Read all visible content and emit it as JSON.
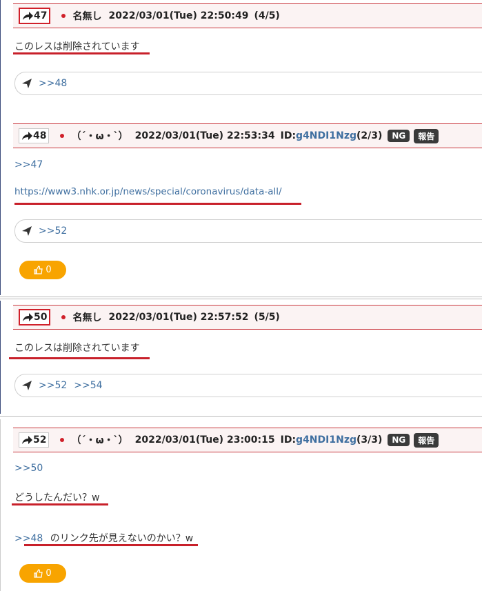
{
  "posts": [
    {
      "num": "47",
      "name": "名無し",
      "date": "2022/03/01(Tue) 22:50:49",
      "count": "(4/5)",
      "body": "このレスは削除されています",
      "replies": [
        ">>48"
      ]
    },
    {
      "num": "48",
      "name": "（´・ω・`）",
      "date": "2022/03/01(Tue) 22:53:34",
      "id_label": "ID:",
      "id": "g4NDI1Nzg",
      "count": "(2/3)",
      "ng": "NG",
      "report": "報告",
      "anchor": ">>47",
      "url": "https://www3.nhk.or.jp/news/special/coronavirus/data-all/",
      "replies": [
        ">>52"
      ],
      "likes": "0"
    },
    {
      "num": "50",
      "name": "名無し",
      "date": "2022/03/01(Tue) 22:57:52",
      "count": "(5/5)",
      "body": "このレスは削除されています",
      "replies": [
        ">>52",
        ">>54"
      ]
    },
    {
      "num": "52",
      "name": "（´・ω・`）",
      "date": "2022/03/01(Tue) 23:00:15",
      "id_label": "ID:",
      "id": "g4NDI1Nzg",
      "count": "(3/3)",
      "ng": "NG",
      "report": "報告",
      "anchor": ">>50",
      "line1": "どうしたんだい？w",
      "line2_anchor": ">>48",
      "line2_text": "のリンク先が見えないのかい？w",
      "likes": "0"
    }
  ],
  "colors": {
    "accent_red": "#d0202a",
    "link": "#3f6fa0",
    "like": "#f8a400"
  },
  "icons": {
    "res_number": "share-arrow-icon",
    "reply": "paper-plane-icon",
    "like": "thumbs-up-icon"
  }
}
